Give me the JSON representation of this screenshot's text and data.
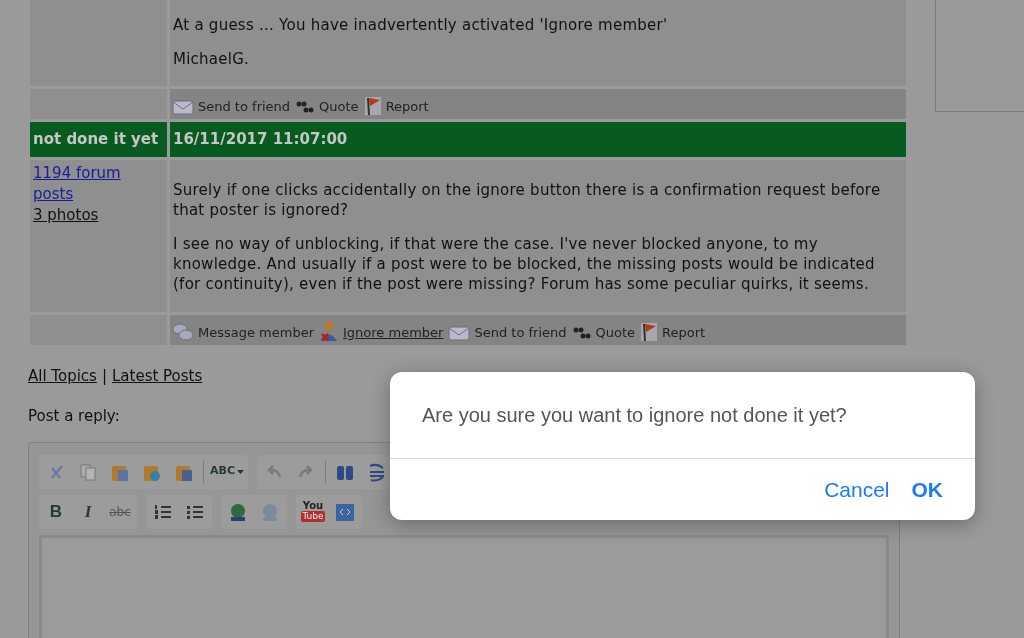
{
  "posts": [
    {
      "paragraphs": [
        "At a guess ... You have inadvertently activated 'Ignore member'",
        "MichaelG."
      ],
      "actions": [
        {
          "kind": "send",
          "label": "Send to friend",
          "link": false
        },
        {
          "kind": "quote",
          "label": "Quote",
          "link": false
        },
        {
          "kind": "report",
          "label": "Report",
          "link": false
        }
      ]
    },
    {
      "author": "not done it yet",
      "date": "16/11/2017 11:07:00",
      "stats": [
        {
          "label": "1194 forum posts",
          "kind": "posts"
        },
        {
          "label": "3 photos",
          "kind": "photos"
        }
      ],
      "paragraphs": [
        "Surely if one clicks accidentally on the ignore button there is a confirmation request before that poster is ignored?",
        "I see no way of unblocking, if that were the case. I've never blocked anyone, to my knowledge. And usually if a post were to be blocked, the missing posts would be indicated (for continuity), even if the post were missing? Forum has some peculiar quirks, it seems."
      ],
      "actions": [
        {
          "kind": "message",
          "label": "Message member",
          "link": false
        },
        {
          "kind": "ignore",
          "label": "Ignore member",
          "link": true
        },
        {
          "kind": "send",
          "label": "Send to friend",
          "link": false
        },
        {
          "kind": "quote",
          "label": "Quote",
          "link": false
        },
        {
          "kind": "report",
          "label": "Report",
          "link": false
        }
      ]
    }
  ],
  "nav_links": [
    "All Topics",
    "Latest Posts"
  ],
  "nav_separator": "|",
  "reply_label": "Post a reply:",
  "toolbar_rows": [
    [
      {
        "kind": "cut"
      },
      {
        "kind": "copy"
      },
      {
        "kind": "paste"
      },
      {
        "kind": "paste-text"
      },
      {
        "kind": "paste-word"
      },
      {
        "kind": "separator"
      },
      {
        "kind": "spell",
        "label": "ABC"
      },
      {
        "kind": "group"
      },
      {
        "kind": "undo"
      },
      {
        "kind": "redo"
      },
      {
        "kind": "separator"
      },
      {
        "kind": "find"
      },
      {
        "kind": "replace"
      }
    ],
    [
      {
        "kind": "bold",
        "label": "B"
      },
      {
        "kind": "italic",
        "label": "I"
      },
      {
        "kind": "strike",
        "label": "abc"
      },
      {
        "kind": "group"
      },
      {
        "kind": "ol"
      },
      {
        "kind": "ul"
      },
      {
        "kind": "group"
      },
      {
        "kind": "link"
      },
      {
        "kind": "unlink"
      },
      {
        "kind": "group"
      },
      {
        "kind": "youtube",
        "label": "You",
        "label_2": "Tube"
      },
      {
        "kind": "source"
      }
    ]
  ],
  "dialog": {
    "message": "Are you sure you want to ignore not done it yet?",
    "buttons": [
      {
        "label": "Cancel",
        "default": false
      },
      {
        "label": "OK",
        "default": true
      }
    ]
  }
}
